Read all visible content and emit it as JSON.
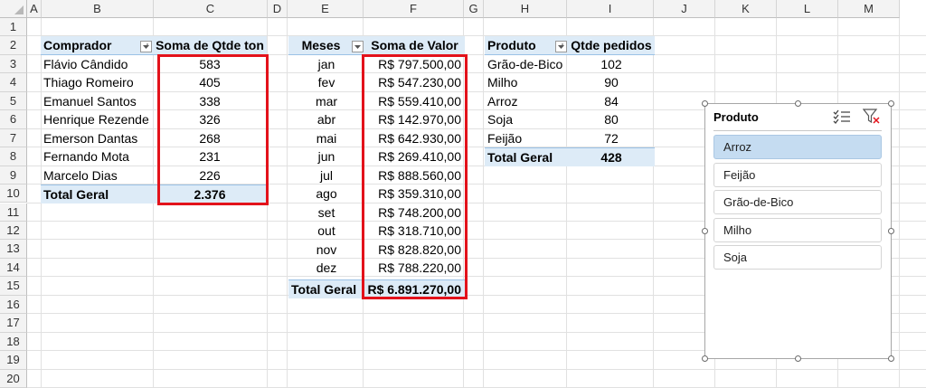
{
  "columns": [
    "A",
    "B",
    "C",
    "D",
    "E",
    "F",
    "G",
    "H",
    "I",
    "J",
    "K",
    "L",
    "M"
  ],
  "rows": [
    "1",
    "2",
    "3",
    "4",
    "5",
    "6",
    "7",
    "8",
    "9",
    "10",
    "11",
    "12",
    "13",
    "14",
    "15",
    "16",
    "17",
    "18",
    "19",
    "20"
  ],
  "pivot1": {
    "header_left": "Comprador",
    "header_right": "Soma de Qtde ton",
    "rows": [
      {
        "name": "Flávio Cândido",
        "value": "583"
      },
      {
        "name": "Thiago Romeiro",
        "value": "405"
      },
      {
        "name": "Emanuel Santos",
        "value": "338"
      },
      {
        "name": "Henrique Rezende",
        "value": "326"
      },
      {
        "name": "Emerson Dantas",
        "value": "268"
      },
      {
        "name": "Fernando Mota",
        "value": "231"
      },
      {
        "name": "Marcelo Dias",
        "value": "226"
      }
    ],
    "total_label": "Total Geral",
    "total_value": "2.376"
  },
  "pivot2": {
    "header_left": "Meses",
    "header_right": "Soma de Valor",
    "rows": [
      {
        "name": "jan",
        "value": "R$ 797.500,00"
      },
      {
        "name": "fev",
        "value": "R$ 547.230,00"
      },
      {
        "name": "mar",
        "value": "R$ 559.410,00"
      },
      {
        "name": "abr",
        "value": "R$ 142.970,00"
      },
      {
        "name": "mai",
        "value": "R$ 642.930,00"
      },
      {
        "name": "jun",
        "value": "R$ 269.410,00"
      },
      {
        "name": "jul",
        "value": "R$ 888.560,00"
      },
      {
        "name": "ago",
        "value": "R$ 359.310,00"
      },
      {
        "name": "set",
        "value": "R$ 748.200,00"
      },
      {
        "name": "out",
        "value": "R$ 318.710,00"
      },
      {
        "name": "nov",
        "value": "R$ 828.820,00"
      },
      {
        "name": "dez",
        "value": "R$ 788.220,00"
      }
    ],
    "total_label": "Total Geral",
    "total_value": "R$ 6.891.270,00"
  },
  "pivot3": {
    "header_left": "Produto",
    "header_right": "Qtde pedidos",
    "rows": [
      {
        "name": "Grão-de-Bico",
        "value": "102"
      },
      {
        "name": "Milho",
        "value": "90"
      },
      {
        "name": "Arroz",
        "value": "84"
      },
      {
        "name": "Soja",
        "value": "80"
      },
      {
        "name": "Feijão",
        "value": "72"
      }
    ],
    "total_label": "Total Geral",
    "total_value": "428"
  },
  "slicer": {
    "title": "Produto",
    "items": [
      {
        "label": "Arroz",
        "selected": true
      },
      {
        "label": "Feijão",
        "selected": false
      },
      {
        "label": "Grão-de-Bico",
        "selected": false
      },
      {
        "label": "Milho",
        "selected": false
      },
      {
        "label": "Soja",
        "selected": false
      }
    ],
    "multiselect_icon": "multi-select-icon",
    "clear_filter_icon": "clear-filter-icon"
  },
  "colors": {
    "pivot_header_bg": "#ddebf7",
    "highlight_border": "#e3121b",
    "slicer_selected_bg": "#c5dcf1"
  }
}
